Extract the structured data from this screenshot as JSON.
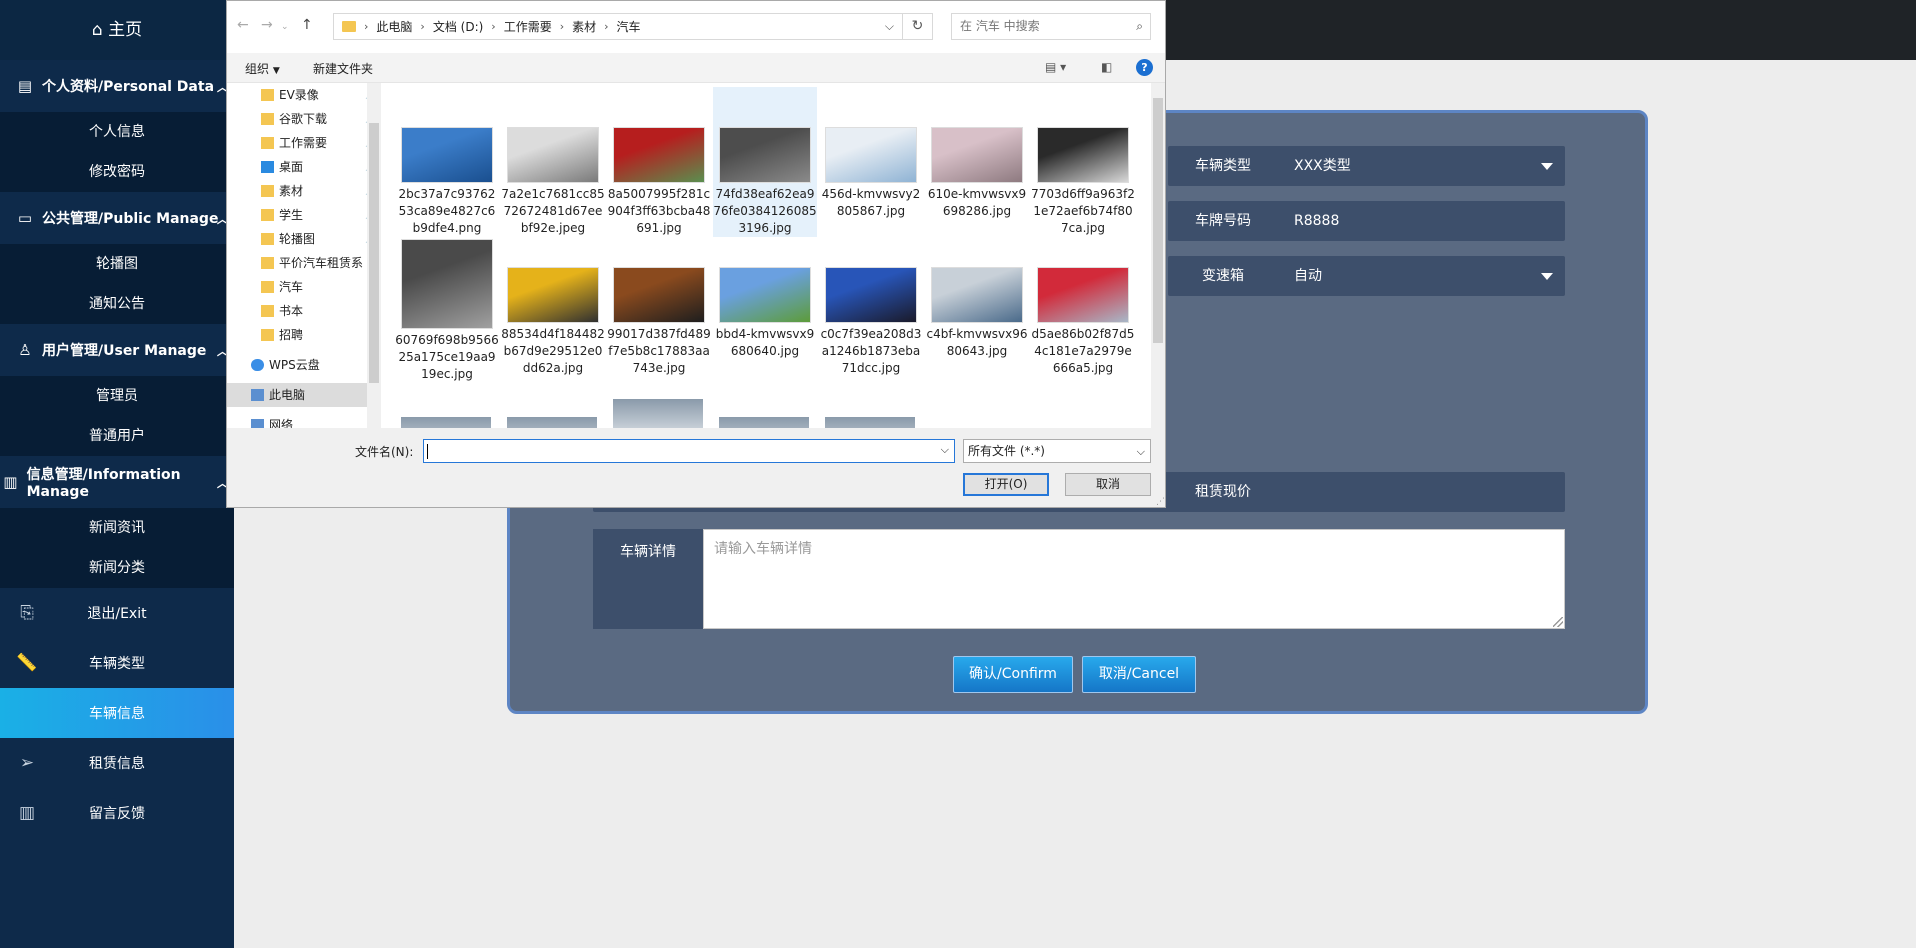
{
  "sidebar": {
    "home": "主页",
    "groups": [
      {
        "label": "个人资料/Personal Data",
        "items": [
          "个人信息",
          "修改密码"
        ]
      },
      {
        "label": "公共管理/Public Manage",
        "items": [
          "轮播图",
          "通知公告"
        ]
      },
      {
        "label": "用户管理/User Manage",
        "items": [
          "管理员",
          "普通用户"
        ]
      },
      {
        "label": "信息管理/Information Manage",
        "items": [
          "新闻资讯",
          "新闻分类"
        ]
      }
    ],
    "items": [
      {
        "label": "退出/Exit",
        "icon": "exit-icon"
      },
      {
        "label": "车辆类型",
        "icon": "ruler-icon"
      },
      {
        "label": "车辆信息",
        "icon": "car-icon",
        "active": true
      },
      {
        "label": "租赁信息",
        "icon": "send-icon"
      },
      {
        "label": "留言反馈",
        "icon": "books-icon"
      }
    ],
    "accent": "#1ab0e6"
  },
  "form": {
    "type_label": "车辆类型",
    "type_value": "XXX类型",
    "plate_label": "车牌号码",
    "plate_value": "R8888",
    "gearbox_label": "变速箱",
    "gearbox_value": "自动",
    "price_label": "租赁现价",
    "detail_label": "车辆详情",
    "detail_placeholder": "请输入车辆详情",
    "confirm": "确认/Confirm",
    "cancel": "取消/Cancel"
  },
  "dialog": {
    "breadcrumbs": [
      "此电脑",
      "文档 (D:)",
      "工作需要",
      "素材",
      "汽车"
    ],
    "search_placeholder": "在 汽车 中搜索",
    "toolbar": {
      "organize": "组织",
      "new_folder": "新建文件夹"
    },
    "nav": [
      {
        "label": "EV录像",
        "pinned": true
      },
      {
        "label": "谷歌下载",
        "pinned": true
      },
      {
        "label": "工作需要",
        "pinned": true
      },
      {
        "label": "桌面",
        "pinned": true
      },
      {
        "label": "素材",
        "pinned": true
      },
      {
        "label": "学生",
        "pinned": true
      },
      {
        "label": "轮播图",
        "pinned": true
      },
      {
        "label": "平价汽车租赁系",
        "pinned": false
      },
      {
        "label": "汽车",
        "pinned": false
      },
      {
        "label": "书本",
        "pinned": false
      },
      {
        "label": "招聘",
        "pinned": false
      },
      {
        "label": "WPS云盘",
        "pinned": false
      },
      {
        "label": "此电脑",
        "pinned": false
      },
      {
        "label": "网络",
        "pinned": false
      }
    ],
    "files": [
      {
        "name": "2bc37a7c9376253ca89e4827c6b9dfe4.png",
        "colors": [
          "#3b7dc9",
          "#1a4f8f"
        ]
      },
      {
        "name": "7a2e1c7681cc8572672481d67eebf92e.jpeg",
        "colors": [
          "#dcdcdc",
          "#7a7a7a"
        ]
      },
      {
        "name": "8a5007995f281c904f3ff63bcba48691.jpg",
        "colors": [
          "#b61e1e",
          "#5a8f4f"
        ]
      },
      {
        "name": "74fd38eaf62ea976fe03841260853196.jpg",
        "colors": [
          "#4d4d4d",
          "#8a8a8a"
        ]
      },
      {
        "name": "456d-kmvwsvy2805867.jpg",
        "colors": [
          "#e8eef4",
          "#8fb3d4"
        ]
      },
      {
        "name": "610e-kmvwsvx9698286.jpg",
        "colors": [
          "#d8c0c8",
          "#8e7a80"
        ]
      },
      {
        "name": "7703d6ff9a963f21e72aef6b74f807ca.jpg",
        "colors": [
          "#2a2a2a",
          "#d8d8d8"
        ]
      },
      {
        "name": "60769f698b956625a175ce19aa919ec.jpg",
        "colors": [
          "#4a4a4a",
          "#a0a0a0"
        ]
      },
      {
        "name": "88534d4f184482b67d9e29512e0dd62a.jpg",
        "colors": [
          "#e5b21a",
          "#303030"
        ]
      },
      {
        "name": "99017d387fd489f7e5b8c17883aa743e.jpg",
        "colors": [
          "#8a4a1e",
          "#1e1e1e"
        ]
      },
      {
        "name": "bbd4-kmvwsvx9680640.jpg",
        "colors": [
          "#6aa0e0",
          "#5d9c3a"
        ]
      },
      {
        "name": "c0c7f39ea208d3a1246b1873eba71dcc.jpg",
        "colors": [
          "#2855b8",
          "#1a1a2a"
        ]
      },
      {
        "name": "c4bf-kmvwsvx9680643.jpg",
        "colors": [
          "#c8d0d8",
          "#4a6a8a"
        ]
      },
      {
        "name": "d5ae86b02f87d54c181e7a2979e666a5.jpg",
        "colors": [
          "#d22a3a",
          "#a8b8c8"
        ]
      }
    ],
    "filename_label": "文件名(N):",
    "filetype": "所有文件 (*.*)",
    "open": "打开(O)",
    "cancel": "取消"
  }
}
